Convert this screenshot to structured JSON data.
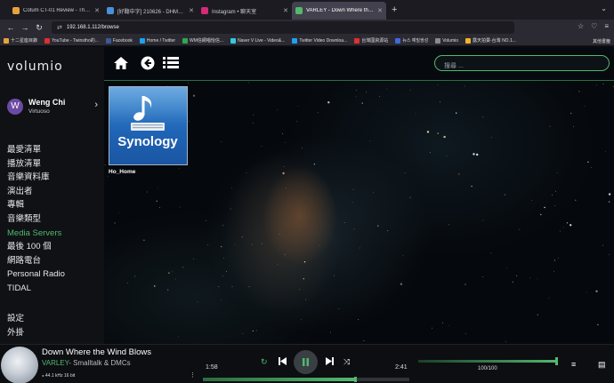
{
  "browser": {
    "tabs": [
      {
        "title": "Cotum CT-01 Review - The 21st Ce",
        "color": "#e6a23c",
        "active": false
      },
      {
        "title": "[好聽中字] 210626 - DHMYGIRL S",
        "color": "#4a90d9",
        "active": false
      },
      {
        "title": "Instagram • 聊天室",
        "color": "#d62976",
        "active": false
      },
      {
        "title": "VARLEY - Down Where the Wind B",
        "color": "#53b86e",
        "active": true
      }
    ],
    "url": "192.168.1.112/browse",
    "bookmarks": [
      {
        "label": "十二星座目錄",
        "color": "#e6a23c"
      },
      {
        "label": "YouTube - Twinstho的...",
        "color": "#e02f2f"
      },
      {
        "label": "Facebook",
        "color": "#3b5998"
      },
      {
        "label": "Home / Twitter",
        "color": "#1da1f2"
      },
      {
        "label": "WM信網唱恰信...",
        "color": "#2fa84f"
      },
      {
        "label": "Naver V Live - Video&...",
        "color": "#35c8e0"
      },
      {
        "label": "Twitter Video Downloa...",
        "color": "#1da1f2"
      },
      {
        "label": "台灣國資源站",
        "color": "#e02f2f"
      },
      {
        "label": "뉴스 예빌쌍성",
        "color": "#3f6ad8"
      },
      {
        "label": "Volumio",
        "color": "#8a8a8a"
      },
      {
        "label": "露天拍賣-台灣 NO.1...",
        "color": "#f0b429"
      }
    ],
    "bookmarks_other": "其他書籤"
  },
  "app": {
    "logo": "volumio",
    "user": {
      "initial": "W",
      "name": "Weng Chi",
      "role": "Virtuoso"
    },
    "menu": [
      {
        "label": "最愛清單",
        "active": false
      },
      {
        "label": "播放清單",
        "active": false
      },
      {
        "label": "音樂資料庫",
        "active": false
      },
      {
        "label": "演出者",
        "active": false
      },
      {
        "label": "專輯",
        "active": false
      },
      {
        "label": "音樂類型",
        "active": false
      },
      {
        "label": "Media Servers",
        "active": true
      },
      {
        "label": "最後 100 個",
        "active": false
      },
      {
        "label": "網路電台",
        "active": false
      },
      {
        "label": "Personal Radio",
        "active": false
      },
      {
        "label": "TIDAL",
        "active": false
      }
    ],
    "menu_bottom": [
      "設定",
      "外掛"
    ],
    "search_placeholder": "搜尋 ...",
    "tile": {
      "brand": "Synology",
      "label": "Ho_Home"
    },
    "accent": "#53b86e"
  },
  "player": {
    "title": "Down Where the Wind Blows",
    "artist": "VARLEY",
    "album": "- Smalltalk & DMCs",
    "format": "44.1 kHz 16 bit",
    "elapsed": "1:58",
    "duration": "2:41",
    "progress_fraction": 0.733,
    "volume": "100/100",
    "volume_fraction": 1.0
  }
}
